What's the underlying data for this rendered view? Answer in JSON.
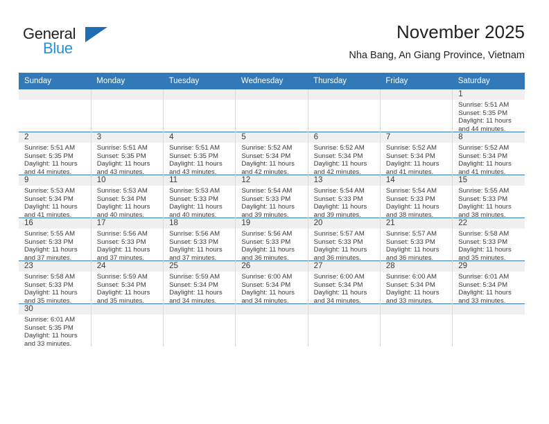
{
  "brand": {
    "name_part1": "General",
    "name_part2": "Blue",
    "triangle_color": "#1f6cb0",
    "blue_text_color": "#2b8fd4"
  },
  "header": {
    "month_title": "November 2025",
    "location": "Nha Bang, An Giang Province, Vietnam"
  },
  "theme": {
    "header_row_color": "#3279b8",
    "daynum_strip_color": "#f0f0f0",
    "grid_line_color": "#c8c8c8"
  },
  "weekdays": [
    "Sunday",
    "Monday",
    "Tuesday",
    "Wednesday",
    "Thursday",
    "Friday",
    "Saturday"
  ],
  "weeks": [
    [
      {
        "day": "",
        "blank": true
      },
      {
        "day": "",
        "blank": true
      },
      {
        "day": "",
        "blank": true
      },
      {
        "day": "",
        "blank": true
      },
      {
        "day": "",
        "blank": true
      },
      {
        "day": "",
        "blank": true
      },
      {
        "day": "1",
        "sunrise": "Sunrise: 5:51 AM",
        "sunset": "Sunset: 5:35 PM",
        "daylight1": "Daylight: 11 hours",
        "daylight2": "and 44 minutes."
      }
    ],
    [
      {
        "day": "2",
        "sunrise": "Sunrise: 5:51 AM",
        "sunset": "Sunset: 5:35 PM",
        "daylight1": "Daylight: 11 hours",
        "daylight2": "and 44 minutes."
      },
      {
        "day": "3",
        "sunrise": "Sunrise: 5:51 AM",
        "sunset": "Sunset: 5:35 PM",
        "daylight1": "Daylight: 11 hours",
        "daylight2": "and 43 minutes."
      },
      {
        "day": "4",
        "sunrise": "Sunrise: 5:51 AM",
        "sunset": "Sunset: 5:35 PM",
        "daylight1": "Daylight: 11 hours",
        "daylight2": "and 43 minutes."
      },
      {
        "day": "5",
        "sunrise": "Sunrise: 5:52 AM",
        "sunset": "Sunset: 5:34 PM",
        "daylight1": "Daylight: 11 hours",
        "daylight2": "and 42 minutes."
      },
      {
        "day": "6",
        "sunrise": "Sunrise: 5:52 AM",
        "sunset": "Sunset: 5:34 PM",
        "daylight1": "Daylight: 11 hours",
        "daylight2": "and 42 minutes."
      },
      {
        "day": "7",
        "sunrise": "Sunrise: 5:52 AM",
        "sunset": "Sunset: 5:34 PM",
        "daylight1": "Daylight: 11 hours",
        "daylight2": "and 41 minutes."
      },
      {
        "day": "8",
        "sunrise": "Sunrise: 5:52 AM",
        "sunset": "Sunset: 5:34 PM",
        "daylight1": "Daylight: 11 hours",
        "daylight2": "and 41 minutes."
      }
    ],
    [
      {
        "day": "9",
        "sunrise": "Sunrise: 5:53 AM",
        "sunset": "Sunset: 5:34 PM",
        "daylight1": "Daylight: 11 hours",
        "daylight2": "and 41 minutes."
      },
      {
        "day": "10",
        "sunrise": "Sunrise: 5:53 AM",
        "sunset": "Sunset: 5:34 PM",
        "daylight1": "Daylight: 11 hours",
        "daylight2": "and 40 minutes."
      },
      {
        "day": "11",
        "sunrise": "Sunrise: 5:53 AM",
        "sunset": "Sunset: 5:33 PM",
        "daylight1": "Daylight: 11 hours",
        "daylight2": "and 40 minutes."
      },
      {
        "day": "12",
        "sunrise": "Sunrise: 5:54 AM",
        "sunset": "Sunset: 5:33 PM",
        "daylight1": "Daylight: 11 hours",
        "daylight2": "and 39 minutes."
      },
      {
        "day": "13",
        "sunrise": "Sunrise: 5:54 AM",
        "sunset": "Sunset: 5:33 PM",
        "daylight1": "Daylight: 11 hours",
        "daylight2": "and 39 minutes."
      },
      {
        "day": "14",
        "sunrise": "Sunrise: 5:54 AM",
        "sunset": "Sunset: 5:33 PM",
        "daylight1": "Daylight: 11 hours",
        "daylight2": "and 38 minutes."
      },
      {
        "day": "15",
        "sunrise": "Sunrise: 5:55 AM",
        "sunset": "Sunset: 5:33 PM",
        "daylight1": "Daylight: 11 hours",
        "daylight2": "and 38 minutes."
      }
    ],
    [
      {
        "day": "16",
        "sunrise": "Sunrise: 5:55 AM",
        "sunset": "Sunset: 5:33 PM",
        "daylight1": "Daylight: 11 hours",
        "daylight2": "and 37 minutes."
      },
      {
        "day": "17",
        "sunrise": "Sunrise: 5:56 AM",
        "sunset": "Sunset: 5:33 PM",
        "daylight1": "Daylight: 11 hours",
        "daylight2": "and 37 minutes."
      },
      {
        "day": "18",
        "sunrise": "Sunrise: 5:56 AM",
        "sunset": "Sunset: 5:33 PM",
        "daylight1": "Daylight: 11 hours",
        "daylight2": "and 37 minutes."
      },
      {
        "day": "19",
        "sunrise": "Sunrise: 5:56 AM",
        "sunset": "Sunset: 5:33 PM",
        "daylight1": "Daylight: 11 hours",
        "daylight2": "and 36 minutes."
      },
      {
        "day": "20",
        "sunrise": "Sunrise: 5:57 AM",
        "sunset": "Sunset: 5:33 PM",
        "daylight1": "Daylight: 11 hours",
        "daylight2": "and 36 minutes."
      },
      {
        "day": "21",
        "sunrise": "Sunrise: 5:57 AM",
        "sunset": "Sunset: 5:33 PM",
        "daylight1": "Daylight: 11 hours",
        "daylight2": "and 36 minutes."
      },
      {
        "day": "22",
        "sunrise": "Sunrise: 5:58 AM",
        "sunset": "Sunset: 5:33 PM",
        "daylight1": "Daylight: 11 hours",
        "daylight2": "and 35 minutes."
      }
    ],
    [
      {
        "day": "23",
        "sunrise": "Sunrise: 5:58 AM",
        "sunset": "Sunset: 5:33 PM",
        "daylight1": "Daylight: 11 hours",
        "daylight2": "and 35 minutes."
      },
      {
        "day": "24",
        "sunrise": "Sunrise: 5:59 AM",
        "sunset": "Sunset: 5:34 PM",
        "daylight1": "Daylight: 11 hours",
        "daylight2": "and 35 minutes."
      },
      {
        "day": "25",
        "sunrise": "Sunrise: 5:59 AM",
        "sunset": "Sunset: 5:34 PM",
        "daylight1": "Daylight: 11 hours",
        "daylight2": "and 34 minutes."
      },
      {
        "day": "26",
        "sunrise": "Sunrise: 6:00 AM",
        "sunset": "Sunset: 5:34 PM",
        "daylight1": "Daylight: 11 hours",
        "daylight2": "and 34 minutes."
      },
      {
        "day": "27",
        "sunrise": "Sunrise: 6:00 AM",
        "sunset": "Sunset: 5:34 PM",
        "daylight1": "Daylight: 11 hours",
        "daylight2": "and 34 minutes."
      },
      {
        "day": "28",
        "sunrise": "Sunrise: 6:00 AM",
        "sunset": "Sunset: 5:34 PM",
        "daylight1": "Daylight: 11 hours",
        "daylight2": "and 33 minutes."
      },
      {
        "day": "29",
        "sunrise": "Sunrise: 6:01 AM",
        "sunset": "Sunset: 5:34 PM",
        "daylight1": "Daylight: 11 hours",
        "daylight2": "and 33 minutes."
      }
    ],
    [
      {
        "day": "30",
        "sunrise": "Sunrise: 6:01 AM",
        "sunset": "Sunset: 5:35 PM",
        "daylight1": "Daylight: 11 hours",
        "daylight2": "and 33 minutes."
      },
      {
        "day": "",
        "blank": true
      },
      {
        "day": "",
        "blank": true
      },
      {
        "day": "",
        "blank": true
      },
      {
        "day": "",
        "blank": true
      },
      {
        "day": "",
        "blank": true
      },
      {
        "day": "",
        "blank": true
      }
    ]
  ]
}
